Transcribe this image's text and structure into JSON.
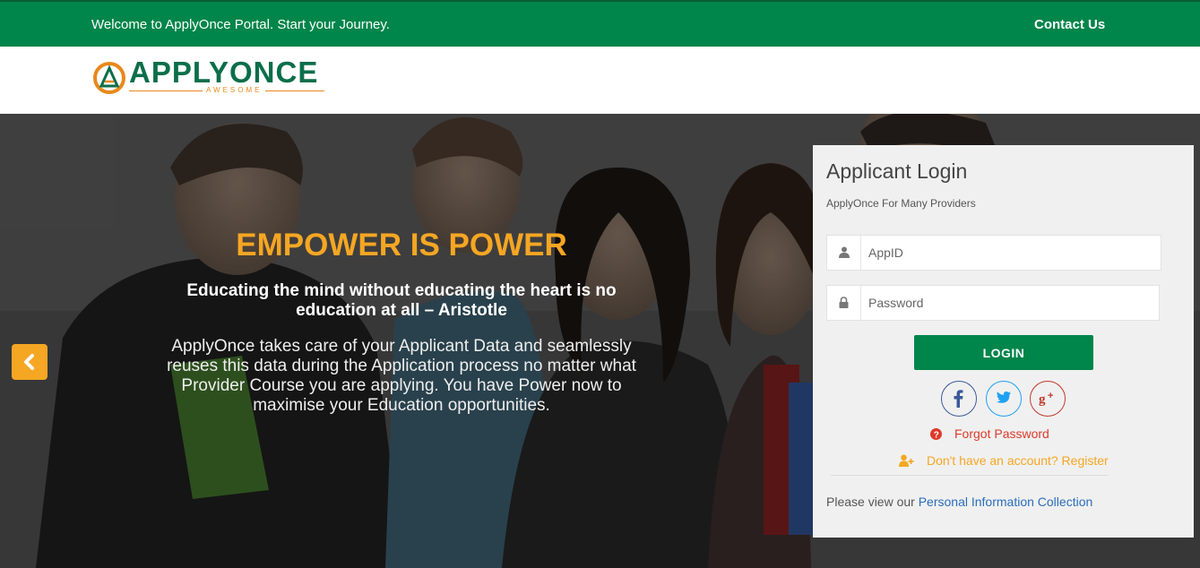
{
  "topbar": {
    "welcome": "Welcome to ApplyOnce Portal. Start your Journey.",
    "contact": "Contact Us"
  },
  "logo": {
    "name": "APPLYONCE",
    "tagline": "AWESOME"
  },
  "hero": {
    "title": "EMPOWER IS POWER",
    "quote": "Educating the mind without educating the heart is no education at all – Aristotle",
    "body": "ApplyOnce takes care of your Applicant Data and seamlessly reuses this data during the Application process no matter what Provider Course you are applying. You have Power now to maximise your Education opportunities."
  },
  "login": {
    "title": "Applicant Login",
    "subtitle": "ApplyOnce For Many Providers",
    "appid_placeholder": "AppID",
    "password_placeholder": "Password",
    "login_label": "LOGIN",
    "forgot_label": "Forgot Password",
    "register_label": "Don't have an account? Register",
    "privacy_prefix": "Please view our",
    "privacy_link": "Personal Information Collection"
  },
  "icons": {
    "user": "user-icon",
    "lock": "lock-icon",
    "facebook": "facebook-icon",
    "twitter": "twitter-icon",
    "google_plus": "google-plus-icon",
    "question": "question-circle-icon",
    "user_add": "user-plus-icon",
    "prev": "chevron-left-icon",
    "next": "chevron-right-icon"
  },
  "colors": {
    "brand_green": "#00854a",
    "accent_orange": "#f5a623",
    "link_blue": "#2a6ebb",
    "danger_red": "#dd3b2b"
  }
}
